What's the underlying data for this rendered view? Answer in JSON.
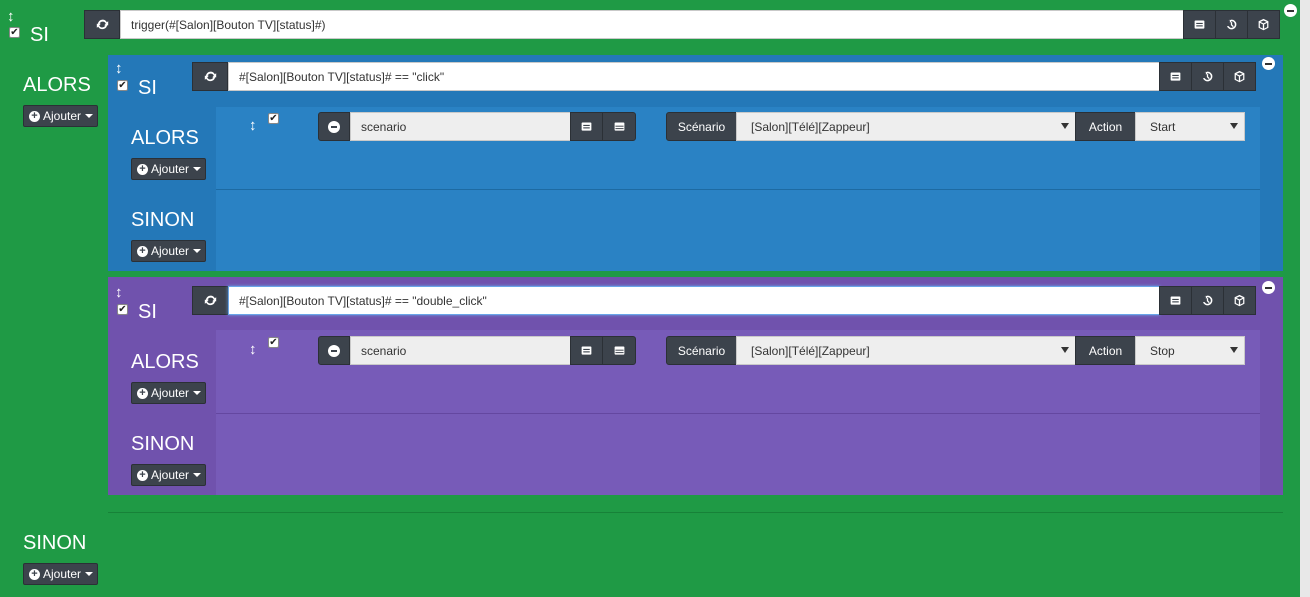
{
  "root": {
    "si_label": "SI",
    "alors_label": "ALORS",
    "sinon_label": "SINON",
    "ajouter_label": "Ajouter",
    "condition": "trigger(#[Salon][Bouton TV][status]#)"
  },
  "block1": {
    "si_label": "SI",
    "alors_label": "ALORS",
    "sinon_label": "SINON",
    "ajouter_label": "Ajouter",
    "condition": "#[Salon][Bouton TV][status]# == \"click\"",
    "action": {
      "command": "scenario",
      "scenario_label": "Scénario",
      "scenario_value": "[Salon][Télé][Zappeur]",
      "action_label": "Action",
      "action_value": "Start"
    }
  },
  "block2": {
    "si_label": "SI",
    "alors_label": "ALORS",
    "sinon_label": "SINON",
    "ajouter_label": "Ajouter",
    "condition": "#[Salon][Bouton TV][status]# == \"double_click\"",
    "action": {
      "command": "scenario",
      "scenario_label": "Scénario",
      "scenario_value": "[Salon][Télé][Zappeur]",
      "action_label": "Action",
      "action_value": "Stop"
    }
  },
  "colors": {
    "green": "#1f9a45",
    "blue": "#2a7fc0",
    "purple": "#7559b5",
    "dark_button": "#3c434c"
  }
}
